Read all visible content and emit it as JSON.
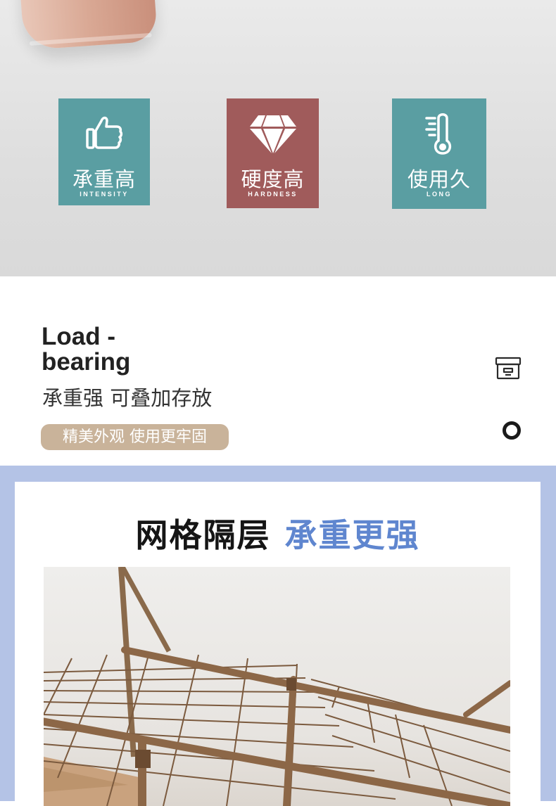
{
  "hero": {
    "features": [
      {
        "icon": "thumbs-up-icon",
        "cn": "承重高",
        "en": "INTENSITY",
        "color": "#5a9ea2"
      },
      {
        "icon": "diamond-icon",
        "cn": "硬度高",
        "en": "HARDNESS",
        "color": "#a05b5b"
      },
      {
        "icon": "thermometer-icon",
        "cn": "使用久",
        "en": "LONG",
        "color": "#5a9ea2"
      }
    ]
  },
  "section": {
    "title_line1": "Load -",
    "title_line2": "bearing",
    "subtitle": "承重强 可叠加存放",
    "pill": "精美外观 使用更牢固",
    "pill_color": "#c9b39a",
    "side_icons": [
      "archive-box-icon",
      "ring-icon"
    ]
  },
  "bottom": {
    "heading_dark": "网格隔层",
    "heading_blue": "承重更强",
    "accent": "#5f86cf",
    "background": "#b4c3e6"
  }
}
